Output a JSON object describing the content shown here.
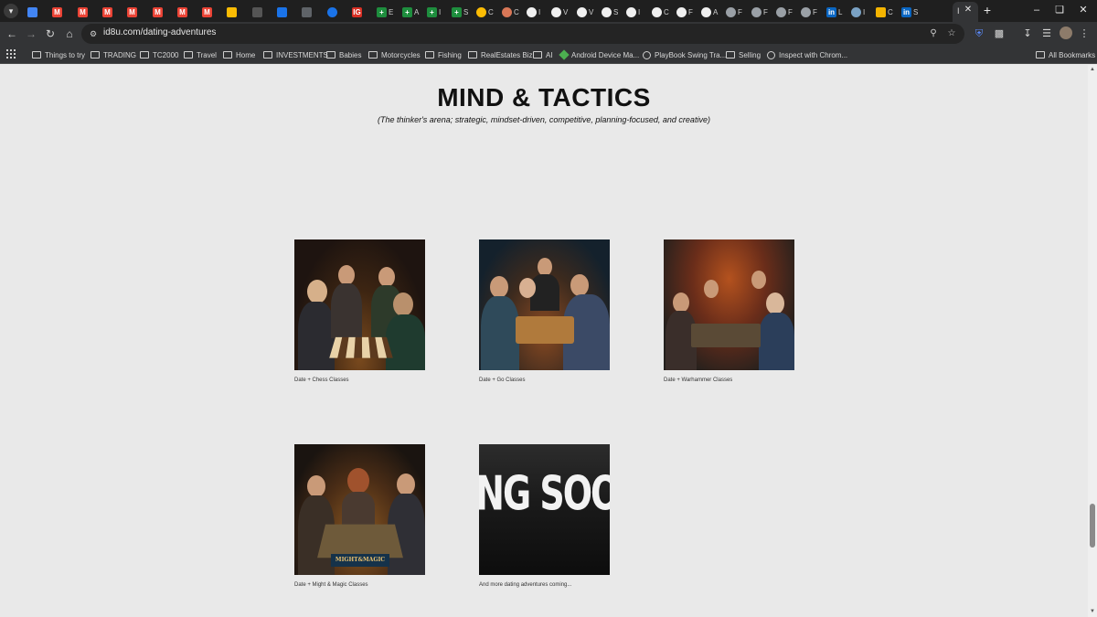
{
  "browser": {
    "tabs": [
      {
        "icon": "google-docs-icon",
        "color": "#4285f4",
        "letter": "",
        "title": ""
      },
      {
        "icon": "gmail-icon",
        "color": "#ea4335",
        "letter": "M",
        "title": ""
      },
      {
        "icon": "gmail-icon",
        "color": "#ea4335",
        "letter": "M",
        "title": ""
      },
      {
        "icon": "gmail-icon",
        "color": "#ea4335",
        "letter": "M",
        "title": ""
      },
      {
        "icon": "gmail-icon",
        "color": "#ea4335",
        "letter": "M",
        "title": ""
      },
      {
        "icon": "gmail-icon",
        "color": "#ea4335",
        "letter": "M",
        "title": ""
      },
      {
        "icon": "gmail-icon",
        "color": "#ea4335",
        "letter": "M",
        "title": ""
      },
      {
        "icon": "gmail-icon",
        "color": "#ea4335",
        "letter": "M",
        "title": ""
      },
      {
        "icon": "google-drive-icon",
        "color": "#fbbc04",
        "letter": "",
        "title": ""
      },
      {
        "icon": "audio-icon",
        "color": "#555555",
        "letter": "",
        "title": ""
      },
      {
        "icon": "chart-icon",
        "color": "#1a73e8",
        "letter": "",
        "title": ""
      },
      {
        "icon": "shield-icon",
        "color": "#5f6368",
        "letter": "",
        "title": ""
      },
      {
        "icon": "info-icon",
        "color": "#1a73e8",
        "letter": "",
        "title": ""
      },
      {
        "icon": "ig-icon",
        "color": "#d93025",
        "letter": "IG",
        "title": ""
      },
      {
        "icon": "sheets-icon",
        "color": "#1e8e3e",
        "letter": "+",
        "title": "E"
      },
      {
        "icon": "sheets-icon",
        "color": "#1e8e3e",
        "letter": "+",
        "title": "A"
      },
      {
        "icon": "sheets-icon",
        "color": "#1e8e3e",
        "letter": "+",
        "title": "I"
      },
      {
        "icon": "sheets-icon",
        "color": "#1e8e3e",
        "letter": "+",
        "title": "S"
      },
      {
        "icon": "sun-icon",
        "color": "#fbbc04",
        "letter": "",
        "title": "C"
      },
      {
        "icon": "claude-icon",
        "color": "#d97757",
        "letter": "",
        "title": "C"
      },
      {
        "icon": "github-icon",
        "color": "#f0f0f0",
        "letter": "",
        "title": "I"
      },
      {
        "icon": "github-icon",
        "color": "#f0f0f0",
        "letter": "",
        "title": "V"
      },
      {
        "icon": "github-icon",
        "color": "#f0f0f0",
        "letter": "",
        "title": "V"
      },
      {
        "icon": "github-icon",
        "color": "#f0f0f0",
        "letter": "",
        "title": "S"
      },
      {
        "icon": "github-icon",
        "color": "#f0f0f0",
        "letter": "",
        "title": "I"
      },
      {
        "icon": "github-icon",
        "color": "#f0f0f0",
        "letter": "",
        "title": "C"
      },
      {
        "icon": "github-icon",
        "color": "#f0f0f0",
        "letter": "",
        "title": "F"
      },
      {
        "icon": "github-icon",
        "color": "#f0f0f0",
        "letter": "",
        "title": "A"
      },
      {
        "icon": "globe-icon",
        "color": "#9aa0a6",
        "letter": "",
        "title": "F"
      },
      {
        "icon": "globe-icon",
        "color": "#9aa0a6",
        "letter": "",
        "title": "F"
      },
      {
        "icon": "globe-icon",
        "color": "#9aa0a6",
        "letter": "",
        "title": "F"
      },
      {
        "icon": "globe-icon",
        "color": "#9aa0a6",
        "letter": "",
        "title": "F"
      },
      {
        "icon": "linkedin-icon",
        "color": "#0a66c2",
        "letter": "in",
        "title": "L"
      },
      {
        "icon": "avatar-icon",
        "color": "#7aa2c4",
        "letter": "",
        "title": "I"
      },
      {
        "icon": "flag-icon",
        "color": "#f4b400",
        "letter": "",
        "title": "C"
      },
      {
        "icon": "linkedin-icon",
        "color": "#0a66c2",
        "letter": "in",
        "title": "S"
      }
    ],
    "active_tab_title": "I",
    "url": "id8u.com/dating-adventures",
    "bookmarks": [
      {
        "label": "Things to try",
        "icon": "folder-icon"
      },
      {
        "label": "TRADING",
        "icon": "folder-icon"
      },
      {
        "label": "TC2000",
        "icon": "folder-icon"
      },
      {
        "label": "Travel",
        "icon": "folder-icon"
      },
      {
        "label": "Home",
        "icon": "folder-icon"
      },
      {
        "label": "INVESTMENTS",
        "icon": "folder-icon"
      },
      {
        "label": "Babies",
        "icon": "folder-icon"
      },
      {
        "label": "Motorcycles",
        "icon": "folder-icon"
      },
      {
        "label": "Fishing",
        "icon": "folder-icon"
      },
      {
        "label": "RealEstates Biz",
        "icon": "folder-icon"
      },
      {
        "label": "AI",
        "icon": "folder-icon"
      },
      {
        "label": "Android Device Ma...",
        "icon": "android-icon"
      },
      {
        "label": "PlayBook Swing Tra...",
        "icon": "globe-icon"
      },
      {
        "label": "Selling",
        "icon": "folder-icon"
      },
      {
        "label": "Inspect with Chrom...",
        "icon": "globe-icon"
      }
    ],
    "all_bookmarks_label": "All Bookmarks"
  },
  "page": {
    "heading": "MIND & TACTICS",
    "subtitle": "(The thinker's arena; strategic, mindset-driven, competitive, planning-focused, and creative)",
    "cards": [
      {
        "caption": "Date + Chess Classes",
        "image": "chess-photo"
      },
      {
        "caption": "Date + Go Classes",
        "image": "go-photo"
      },
      {
        "caption": "Date + Warhammer Classes",
        "image": "warhammer-photo"
      },
      {
        "caption": "Date + Might & Magic Classes",
        "image": "might-magic-photo",
        "box_label": "MIGHT&MAGIC"
      },
      {
        "caption": "And more dating adventures coming...",
        "image": "coming-soon-photo",
        "image_text": "ING SOON"
      }
    ]
  }
}
